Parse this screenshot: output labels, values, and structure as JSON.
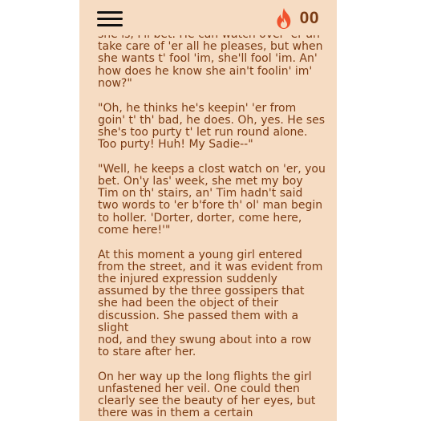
{
  "app": {
    "streak_count": "00",
    "colors": {
      "page_background": "#f6dcc3",
      "text": "#7a3b14",
      "flame": "#f0522d",
      "menu": "#111111"
    }
  },
  "header": {
    "menu_icon": "hamburger-menu-icon",
    "streak_icon": "flame-icon"
  },
  "reader": {
    "paragraphs": [
      "she is, I'll bet. He can watch over 'er an' take care of 'er all he pleases, but when she wants t' fool 'im, she'll fool 'im. An' how does he know she ain't foolin' im' now?\"",
      "\"Oh, he thinks he's keepin' 'er from goin' t' th' bad, he does. Oh, yes. He ses she's too purty t' let run round alone. Too purty! Huh! My Sadie--\"",
      "\"Well, he keeps a clost watch on 'er, you bet. On'y las' week, she met my boy Tim on th' stairs, an' Tim hadn't said two words to 'er b'fore th' ol' man begin to holler. 'Dorter, dorter, come here, come here!'\"",
      "At this moment a young girl entered from the street, and it was evident from the injured expression suddenly assumed by the three gossipers that she had been the object of their discussion. She passed them with a slight\nnod, and they swung about into a row to stare after her.",
      "On her way up the long flights the girl unfastened her veil. One could then clearly see the beauty of her eyes, but there was in them a certain"
    ]
  }
}
